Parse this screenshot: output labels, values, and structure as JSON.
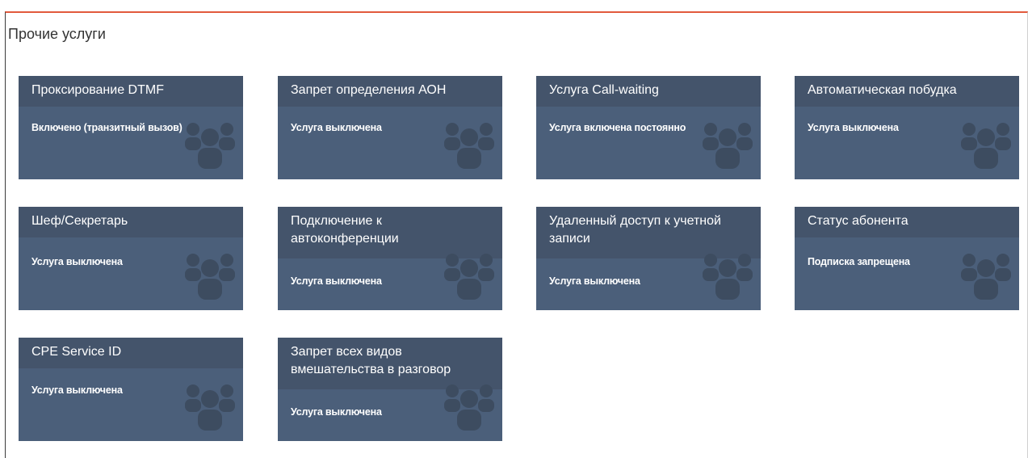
{
  "section": {
    "title": "Прочие услуги"
  },
  "colors": {
    "accent": "#e25a3d",
    "tile_body": "#4b5f7a",
    "tile_head": "#44546b",
    "icon": "#3d4c60"
  },
  "services": [
    {
      "title": "Проксирование DTMF",
      "status": "Включено (транзитный вызов)",
      "icon": "users-icon"
    },
    {
      "title": "Запрет определения АОН",
      "status": "Услуга выключена",
      "icon": "users-icon"
    },
    {
      "title": "Услуга Call-waiting",
      "status": "Услуга включена постоянно",
      "icon": "users-icon"
    },
    {
      "title": "Автоматическая побудка",
      "status": "Услуга выключена",
      "icon": "users-icon"
    },
    {
      "title": "Шеф/Секретарь",
      "status": "Услуга выключена",
      "icon": "users-icon"
    },
    {
      "title": "Подключение к автоконференции",
      "status": "Услуга выключена",
      "icon": "users-icon"
    },
    {
      "title": "Удаленный доступ к учетной записи",
      "status": "Услуга выключена",
      "icon": "users-icon"
    },
    {
      "title": "Статус абонента",
      "status": "Подписка запрещена",
      "icon": "users-icon"
    },
    {
      "title": "CPE Service ID",
      "status": "Услуга выключена",
      "icon": "users-icon"
    },
    {
      "title": "Запрет всех видов вмешательства в разговор",
      "status": "Услуга выключена",
      "icon": "users-icon"
    }
  ]
}
